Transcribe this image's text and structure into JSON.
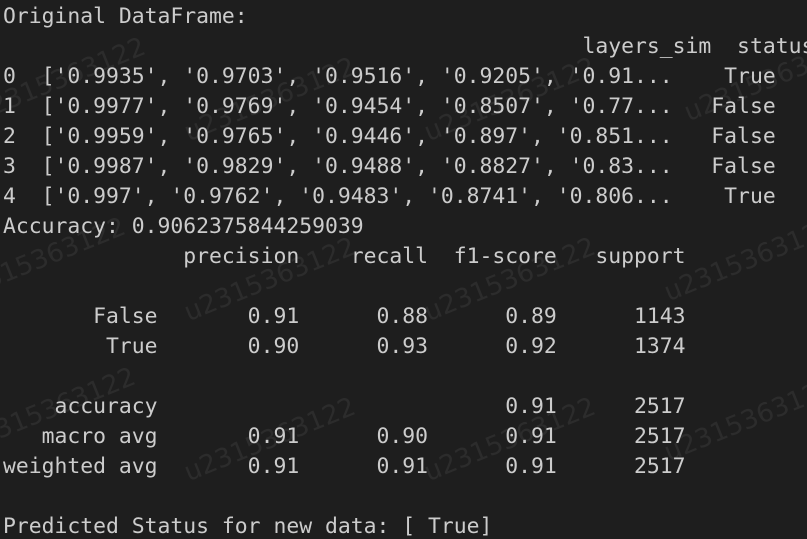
{
  "output_lines": [
    "Original DataFrame:",
    "                                             layers_sim  status",
    "0  ['0.9935', '0.9703', '0.9516', '0.9205', '0.91...    True",
    "1  ['0.9977', '0.9769', '0.9454', '0.8507', '0.77...   False",
    "2  ['0.9959', '0.9765', '0.9446', '0.897', '0.851...   False",
    "3  ['0.9987', '0.9829', '0.9488', '0.8827', '0.83...   False",
    "4  ['0.997', '0.9762', '0.9483', '0.8741', '0.806...    True",
    "Accuracy: 0.9062375844259039",
    "              precision    recall  f1-score   support",
    "",
    "       False       0.91      0.88      0.89      1143",
    "        True       0.90      0.93      0.92      1374",
    "",
    "    accuracy                           0.91      2517",
    "   macro avg       0.91      0.90      0.91      2517",
    "weighted avg       0.91      0.91      0.91      2517",
    "",
    "Predicted Status for new data: [ True]"
  ],
  "watermark": "u2315363122"
}
